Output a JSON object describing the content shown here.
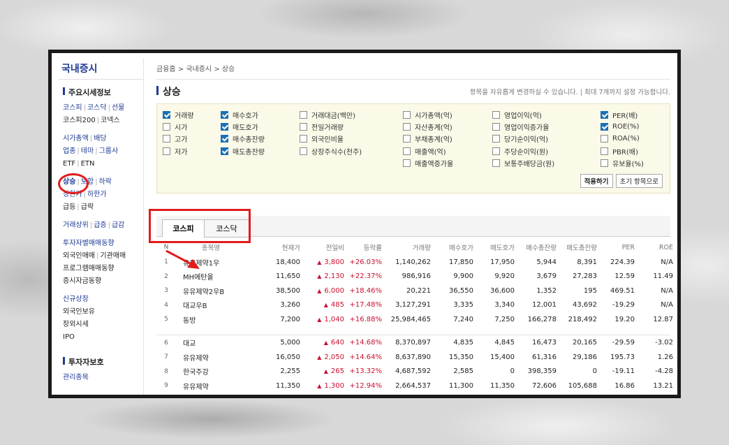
{
  "sidebar": {
    "title": "국내증시",
    "section1_head": "주요시세정보",
    "row1": [
      "코스피",
      "코스닥",
      "선물"
    ],
    "row2": [
      "코스피200",
      "코넥스"
    ],
    "row3": [
      "시가총액",
      "배당"
    ],
    "row4": [
      "업종",
      "테마",
      "그룹사"
    ],
    "row5": [
      "ETF",
      "ETN"
    ],
    "row6": [
      "상승",
      "보합",
      "하락"
    ],
    "row7": [
      "상한가",
      "하한가"
    ],
    "row8": [
      "급등",
      "급락"
    ],
    "row9": [
      "거래상위",
      "급증",
      "급감"
    ],
    "row10": "투자자별매매동향",
    "row11": [
      "외국인매매",
      "기관매매"
    ],
    "row12": "프로그램매매동향",
    "row13": "증시자금동향",
    "row14": "신규상장",
    "row15": "외국인보유",
    "row16": "장외시세",
    "row17": "IPO",
    "section2_head": "투자자보호",
    "section2_partial": "관리종목"
  },
  "breadcrumb": "금융홈 > 국내증시 > 상승",
  "page_title": "상승",
  "title_note": "항목을 자유롭게 변경하실 수 있습니다.  |  최대 7개까지 설정 가능합니다.",
  "options": {
    "col1": [
      {
        "label": "거래량",
        "checked": true
      },
      {
        "label": "시가",
        "checked": false
      },
      {
        "label": "고가",
        "checked": false
      },
      {
        "label": "저가",
        "checked": false
      }
    ],
    "col2": [
      {
        "label": "매수호가",
        "checked": true
      },
      {
        "label": "매도호가",
        "checked": true
      },
      {
        "label": "매수총잔량",
        "checked": true
      },
      {
        "label": "매도총잔량",
        "checked": true
      }
    ],
    "col3": [
      {
        "label": "거래대금(백만)",
        "checked": false
      },
      {
        "label": "전일거래량",
        "checked": false
      },
      {
        "label": "외국인비율",
        "checked": false
      },
      {
        "label": "상장주식수(천주)",
        "checked": false
      }
    ],
    "col4": [
      {
        "label": "시가총액(억)",
        "checked": false
      },
      {
        "label": "자산총계(억)",
        "checked": false
      },
      {
        "label": "부채총계(억)",
        "checked": false
      },
      {
        "label": "매출액(억)",
        "checked": false
      },
      {
        "label": "매출액증가율",
        "checked": false
      }
    ],
    "col5": [
      {
        "label": "영업이익(억)",
        "checked": false
      },
      {
        "label": "영업이익증가율",
        "checked": false
      },
      {
        "label": "당기순이익(억)",
        "checked": false
      },
      {
        "label": "주당순이익(원)",
        "checked": false
      },
      {
        "label": "보통주배당금(원)",
        "checked": false
      }
    ],
    "col6": [
      {
        "label": "PER(배)",
        "checked": true
      },
      {
        "label": "ROE(%)",
        "checked": true
      },
      {
        "label": "ROA(%)",
        "checked": false
      },
      {
        "label": "PBR(배)",
        "checked": false
      },
      {
        "label": "유보율(%)",
        "checked": false
      }
    ],
    "apply_label": "적용하기",
    "reset_label": "초기 항목으로"
  },
  "tabs": [
    "코스피",
    "코스닥"
  ],
  "active_tab": "코스피",
  "table": {
    "headers": [
      "N",
      "종목명",
      "현재가",
      "전일비",
      "등락률",
      "거래량",
      "매수호가",
      "매도호가",
      "매수총잔량",
      "매도총잔량",
      "PER",
      "ROE"
    ],
    "group1": [
      {
        "n": "1",
        "name": "유유제약1우",
        "price": "18,400",
        "chg": "3,800",
        "rate": "+26.03%",
        "vol": "1,140,262",
        "bid": "17,850",
        "ask": "17,950",
        "bq": "5,944",
        "aq": "8,391",
        "per": "224.39",
        "roe": "N/A"
      },
      {
        "n": "2",
        "name": "MH에탄올",
        "price": "11,650",
        "chg": "2,130",
        "rate": "+22.37%",
        "vol": "986,916",
        "bid": "9,900",
        "ask": "9,920",
        "bq": "3,679",
        "aq": "27,283",
        "per": "12.59",
        "roe": "11.49"
      },
      {
        "n": "3",
        "name": "유유제약2우B",
        "price": "38,500",
        "chg": "6,000",
        "rate": "+18.46%",
        "vol": "20,221",
        "bid": "36,550",
        "ask": "36,600",
        "bq": "1,352",
        "aq": "195",
        "per": "469.51",
        "roe": "N/A"
      },
      {
        "n": "4",
        "name": "대교우B",
        "price": "3,260",
        "chg": "485",
        "rate": "+17.48%",
        "vol": "3,127,291",
        "bid": "3,335",
        "ask": "3,340",
        "bq": "12,001",
        "aq": "43,692",
        "per": "-19.29",
        "roe": "N/A"
      },
      {
        "n": "5",
        "name": "동방",
        "price": "7,200",
        "chg": "1,040",
        "rate": "+16.88%",
        "vol": "25,984,465",
        "bid": "7,240",
        "ask": "7,250",
        "bq": "166,278",
        "aq": "218,492",
        "per": "19.20",
        "roe": "12.87"
      }
    ],
    "group2": [
      {
        "n": "6",
        "name": "대교",
        "price": "5,000",
        "chg": "640",
        "rate": "+14.68%",
        "vol": "8,370,897",
        "bid": "4,835",
        "ask": "4,845",
        "bq": "16,473",
        "aq": "20,165",
        "per": "-29.59",
        "roe": "-3.02"
      },
      {
        "n": "7",
        "name": "유유제약",
        "price": "16,050",
        "chg": "2,050",
        "rate": "+14.64%",
        "vol": "8,637,890",
        "bid": "15,350",
        "ask": "15,400",
        "bq": "61,316",
        "aq": "29,186",
        "per": "195.73",
        "roe": "1.26"
      },
      {
        "n": "8",
        "name": "한국주강",
        "price": "2,255",
        "chg": "265",
        "rate": "+13.32%",
        "vol": "4,687,592",
        "bid": "2,585",
        "ask": "0",
        "bq": "398,359",
        "aq": "0",
        "per": "-19.11",
        "roe": "-4.28"
      },
      {
        "n": "9",
        "name": "유유제약",
        "price": "11,350",
        "chg": "1,300",
        "rate": "+12.94%",
        "vol": "2,664,537",
        "bid": "11,300",
        "ask": "11,350",
        "bq": "72,606",
        "aq": "105,688",
        "per": "16.86",
        "roe": "13.21"
      }
    ]
  },
  "colors": {
    "accent": "#1f3a93",
    "up": "#c8102e",
    "highlight": "#e21b1b",
    "check": "#1a6fb8"
  }
}
